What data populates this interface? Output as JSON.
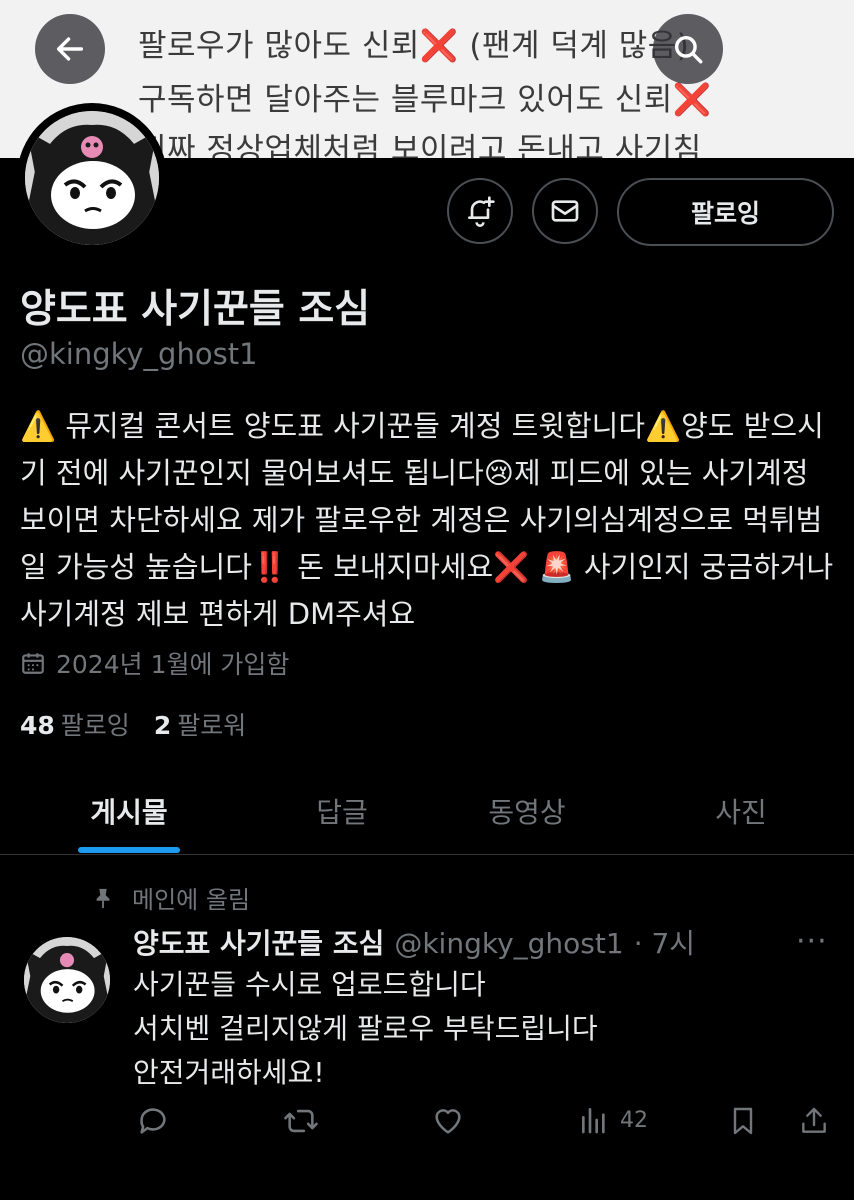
{
  "banner": {
    "lines": [
      {
        "text": "팔로우가 많아도 신뢰",
        "mark": "❌",
        "suffix": " (팬계 덕계 많음)"
      },
      {
        "text": "구독하면 달아주는 블루마크 있어도 신뢰",
        "mark": "❌",
        "suffix": ""
      },
      {
        "text": "진짜 정상업체처럼 보이려고 돈내고 사기침",
        "mark": "",
        "suffix": ""
      }
    ]
  },
  "profile": {
    "display_name": "양도표 사기꾼들 조심",
    "handle": "@kingky_ghost1",
    "follow_label": "팔로잉",
    "bio": "⚠️ 뮤지컬 콘서트 양도표 사기꾼들 계정 트윗합니다⚠️양도 받으시기 전에 사기꾼인지 물어보셔도 됩니다😢제 피드에 있는 사기계정 보이면 차단하세요 제가 팔로우한 계정은 사기의심계정으로 먹튀범일 가능성 높습니다‼️ 돈 보내지마세요❌ 🚨 사기인지 궁금하거나 사기계정 제보 편하게 DM주셔요",
    "joined": "2024년 1월에 가입함",
    "following_count": "48",
    "following_label": "팔로잉",
    "followers_count": "2",
    "followers_label": "팔로워"
  },
  "tabs": [
    {
      "label": "게시물",
      "active": true
    },
    {
      "label": "답글",
      "active": false
    },
    {
      "label": "동영상",
      "active": false
    },
    {
      "label": "사진",
      "active": false
    }
  ],
  "post": {
    "pinned_label": "메인에 올림",
    "author_name": "양도표 사기꾼들 조심",
    "author_handle": "@kingky_ghost1",
    "time": "· 7시",
    "more": "···",
    "text": "사기꾼들 수시로 업로드합니다\n서치벤 걸리지않게 팔로우 부탁드립니다\n안전거래하세요!",
    "views": "42"
  },
  "icons": {
    "back": "arrow-left-icon",
    "search": "search-icon",
    "notify": "bell-plus-icon",
    "message": "envelope-icon",
    "calendar": "calendar-icon",
    "pin": "pin-icon",
    "reply": "reply-icon",
    "repost": "repost-icon",
    "like": "heart-icon",
    "views": "bar-chart-icon",
    "bookmark": "bookmark-icon",
    "share": "share-icon"
  },
  "colors": {
    "accent": "#1d9bf0",
    "background": "#000000",
    "text_primary": "#e7e9ea",
    "text_secondary": "#71767b",
    "error_mark": "#e0202b"
  }
}
